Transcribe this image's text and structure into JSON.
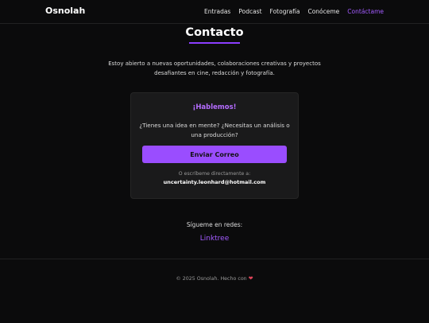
{
  "header": {
    "brand": "Osnolah",
    "nav": [
      {
        "label": "Entradas"
      },
      {
        "label": "Podcast"
      },
      {
        "label": "Fotografía"
      },
      {
        "label": "Conóceme"
      },
      {
        "label": "Contáctame"
      }
    ]
  },
  "main": {
    "title": "Contacto",
    "intro": "Estoy abierto a nuevas oportunidades, colaboraciones creativas y proyectos desafiantes en cine, redacción y fotografía."
  },
  "card": {
    "heading": "¡Hablemos!",
    "text": "¿Tienes una idea en mente? ¿Necesitas un análisis o una producción?",
    "button_label": "Enviar Correo",
    "alt_text": "O escríbeme directamente a:",
    "email": "uncertainty.leonhard@hotmail.com"
  },
  "social": {
    "label": "Sígueme en redes:",
    "link": "Linktree"
  },
  "footer": {
    "text": "© 2025 Osnolah. Hecho con",
    "heart": "❤"
  },
  "colors": {
    "accent": "#9a4dff",
    "background": "#0b0b0c",
    "card": "#1a1a1b"
  }
}
